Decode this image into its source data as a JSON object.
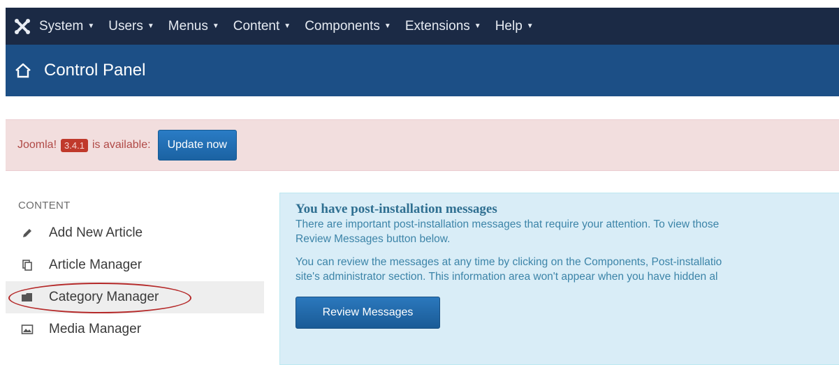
{
  "topbar": {
    "logo_icon": "joomla-logo-icon",
    "menus": [
      {
        "label": "System"
      },
      {
        "label": "Users"
      },
      {
        "label": "Menus"
      },
      {
        "label": "Content"
      },
      {
        "label": "Components"
      },
      {
        "label": "Extensions"
      },
      {
        "label": "Help"
      }
    ]
  },
  "header": {
    "icon": "home-icon",
    "title": "Control Panel"
  },
  "alert": {
    "prefix": "Joomla!",
    "version": "3.4.1",
    "suffix": "is available:",
    "update_label": "Update now"
  },
  "sidebar": {
    "heading": "CONTENT",
    "items": [
      {
        "label": "Add New Article",
        "icon": "pencil-icon"
      },
      {
        "label": "Article Manager",
        "icon": "copy-icon"
      },
      {
        "label": "Category Manager",
        "icon": "folder-icon"
      },
      {
        "label": "Media Manager",
        "icon": "image-icon"
      }
    ]
  },
  "info": {
    "title": "You have post-installation messages",
    "p1_line1": "There are important post-installation messages that require your attention. To view those",
    "p1_line2": "Review Messages button below.",
    "p2_line1": "You can review the messages at any time by clicking on the Components, Post-installatio",
    "p2_line2": "site's administrator section. This information area won't appear when you have hidden al",
    "button_label": "Review Messages"
  },
  "colors": {
    "topbar_bg": "#1b2a45",
    "header_bg": "#1c4f86",
    "alert_bg": "#f2dede",
    "info_bg": "#d9edf7",
    "button_blue": "#1d6bb0",
    "highlight_red": "#b52a2a"
  }
}
